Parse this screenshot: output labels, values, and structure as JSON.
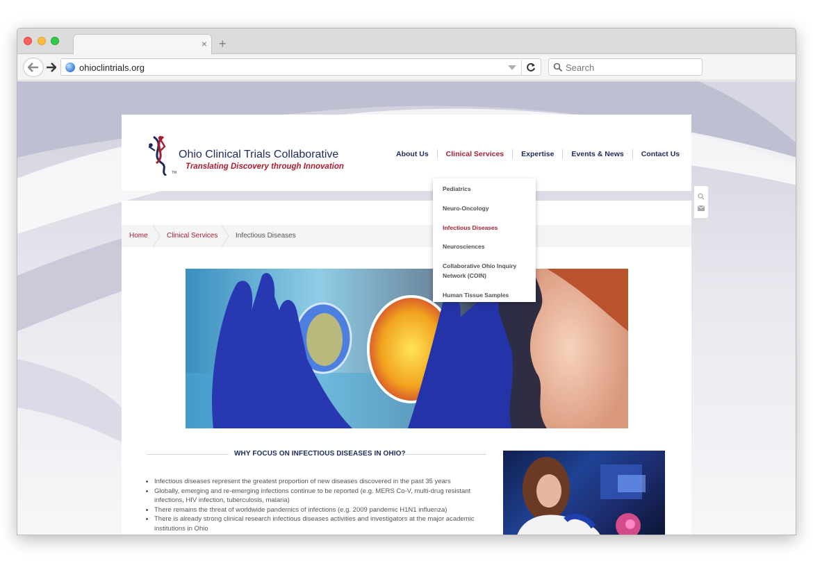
{
  "browser": {
    "url": "ohioclintrials.org",
    "search_placeholder": "Search"
  },
  "site": {
    "logo_title": "Ohio Clinical Trials Collaborative",
    "logo_tagline": "Translating Discovery through Innovation",
    "logo_tm": "TM"
  },
  "nav": {
    "items": [
      {
        "label": "About Us"
      },
      {
        "label": "Clinical Services"
      },
      {
        "label": "Expertise"
      },
      {
        "label": "Events & News"
      },
      {
        "label": "Contact Us"
      }
    ],
    "active_index": 1
  },
  "dropdown": {
    "items": [
      {
        "label": "Pediatrics"
      },
      {
        "label": "Neuro-Oncology"
      },
      {
        "label": "Infectious Diseases"
      },
      {
        "label": "Neurosciences"
      },
      {
        "label": "Collaborative Ohio Inquiry Network (COIN)"
      },
      {
        "label": "Human Tissue Samples"
      }
    ],
    "active_index": 2
  },
  "breadcrumb": {
    "home": "Home",
    "section": "Clinical Services",
    "current": "Infectious Diseases"
  },
  "content": {
    "section_title": "WHY FOCUS ON INFECTIOUS DISEASES IN OHIO?",
    "bullets": [
      "Infectious diseases represent the greatest proportion of new diseases discovered in the past 35 years",
      "Globally, emerging and re-emerging infections continue to be reported (e.g. MERS Co-V, multi-drug resistant infections, HIV infection, tuberculosis, malaria)",
      "There remains the threat of worldwide pandemics of infections (e.g. 2009 pandemic H1N1 influenza)",
      "There is already strong clinical research infectious diseases activities and investigators at the major academic institutions in Ohio"
    ]
  },
  "colors": {
    "brand_navy": "#1e2a5a",
    "brand_red": "#a21f32",
    "background_lavender": "#cfcfdd"
  },
  "icons": {
    "back": "back-arrow-icon",
    "forward": "forward-arrow-icon",
    "reload": "reload-icon",
    "search": "search-icon",
    "globe": "globe-icon",
    "mail": "mail-icon"
  }
}
